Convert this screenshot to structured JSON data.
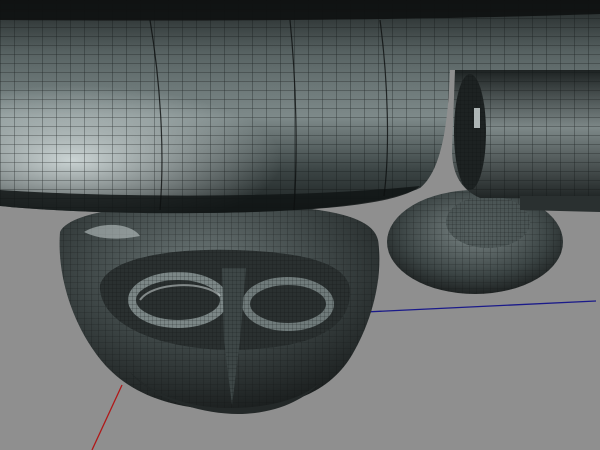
{
  "viewport": {
    "background": "#8f8f8f",
    "mesh_fill_dark": "#2f3434",
    "mesh_fill_mid": "#4d5656",
    "mesh_fill_light": "#b9c2c2",
    "wire_color": "#111414",
    "axis_x_color": "#1a1a8a",
    "axis_y_color": "#b01818"
  }
}
